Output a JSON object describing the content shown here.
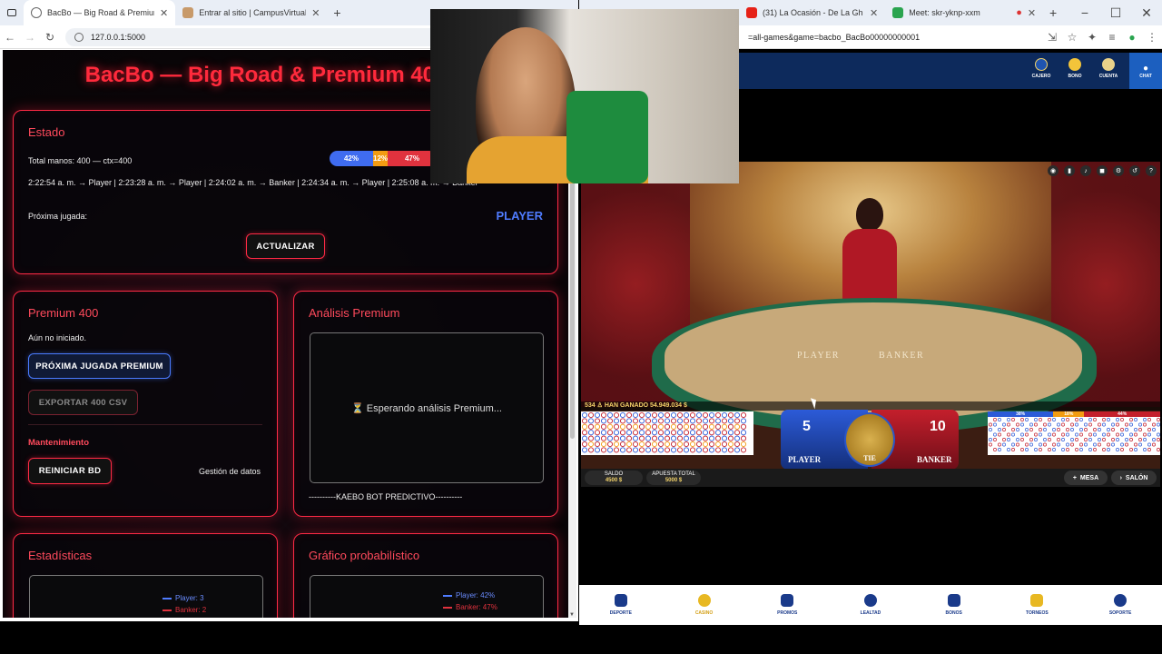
{
  "left_browser": {
    "tabs": [
      {
        "title": "BacBo — Big Road & Premium 40",
        "active": true
      },
      {
        "title": "Entrar al sitio | CampusVirtual - B",
        "active": false
      }
    ],
    "url": "127.0.0.1:5000"
  },
  "right_browser": {
    "tabs": [
      {
        "title": "(31) La Ocasión - De La Gh"
      },
      {
        "title": "Meet: skr-yknp-xxm"
      }
    ],
    "url": "=all-games&game=bacbo_BacBo00000000001"
  },
  "app": {
    "title": "BacBo — Big Road & Premium 400",
    "estado": {
      "heading": "Estado",
      "total_line": "Total manos: 400 — ctx=400",
      "history_line": "2:22:54 a. m. → Player | 2:23:28 a. m. → Player | 2:24:02 a. m. → Banker | 2:24:34 a. m. → Player | 2:25:08 a. m. → Banker",
      "bar": {
        "player_pct": "42%",
        "tie_pct": "12%",
        "banker_pct": "47%"
      },
      "next_label": "Próxima jugada:",
      "next_value": "PLAYER",
      "refresh_button": "ACTUALIZAR"
    },
    "premium": {
      "heading": "Premium 400",
      "status": "Aún no iniciado.",
      "next_premium_button": "PRÓXIMA JUGADA PREMIUM",
      "export_button": "EXPORTAR 400 CSV",
      "maintenance_heading": "Mantenimiento",
      "reset_button": "REINICIAR BD",
      "data_mgmt_label": "Gestión de datos"
    },
    "analysis": {
      "heading": "Análisis Premium",
      "waiting": "⏳ Esperando análisis Premium...",
      "footer": "----------KAEBO BOT PREDICTIVO----------"
    },
    "stats": {
      "heading": "Estadísticas",
      "legend_player": "Player: 3",
      "legend_banker": "Banker: 2"
    },
    "prob_chart": {
      "heading": "Gráfico probabilístico",
      "legend_player": "Player: 42%",
      "legend_banker": "Banker: 47%"
    }
  },
  "casino": {
    "top_menu": [
      "CAJERO",
      "BONO",
      "CUENTA"
    ],
    "chat_label": "CHAT",
    "table_labels": {
      "player": "PLAYER",
      "banker": "BANKER"
    },
    "hud_text": "534 ♙ HAN GANADO 54.949.034 $",
    "scores": {
      "player": "5",
      "banker": "10"
    },
    "score_labels": {
      "player": "PLAYER",
      "tie": "TIE",
      "banker": "BANKER"
    },
    "right_bar": {
      "a": "38%",
      "b": "18%",
      "c": "44%"
    },
    "saldo_label": "SALDO",
    "saldo_value": "4500 $",
    "apuesta_label": "APUESTA TOTAL",
    "apuesta_value": "5000 $",
    "mesa_button": "MESA",
    "salon_button": "SALÓN",
    "footer_nav": [
      "DEPORTE",
      "CASINO",
      "PROMOS",
      "LEALTAD",
      "BONOS",
      "TORNEOS",
      "SOPORTE"
    ],
    "active_footer": "CASINO"
  },
  "colors": {
    "accent_red": "#ff2a45",
    "player_blue": "#4f7cff",
    "banker_red": "#e0323e",
    "tie_orange": "#f39c12"
  }
}
